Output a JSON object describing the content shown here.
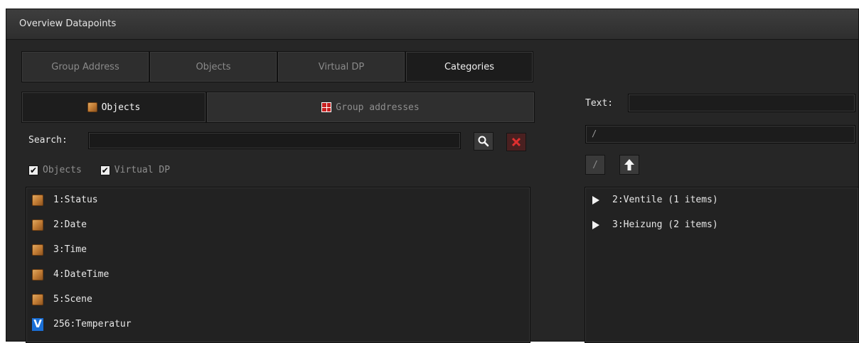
{
  "window": {
    "title": "Overview Datapoints"
  },
  "tabs": [
    {
      "label": "Group Address",
      "active": false
    },
    {
      "label": "Objects",
      "active": false
    },
    {
      "label": "Virtual DP",
      "active": false
    },
    {
      "label": "Categories",
      "active": true
    }
  ],
  "subtabs": {
    "objects": {
      "label": "Objects",
      "icon": "cube-icon"
    },
    "group_addresses": {
      "label": "Group addresses",
      "icon": "group-address-grid-icon"
    }
  },
  "search": {
    "label": "Search:",
    "value": ""
  },
  "filters": [
    {
      "label": "Objects",
      "checked": true
    },
    {
      "label": "Virtual DP",
      "checked": true
    }
  ],
  "objects_list": [
    {
      "label": "1:Status",
      "icon": "cube-icon"
    },
    {
      "label": "2:Date",
      "icon": "cube-icon"
    },
    {
      "label": "3:Time",
      "icon": "cube-icon"
    },
    {
      "label": "4:DateTime",
      "icon": "cube-icon"
    },
    {
      "label": "5:Scene",
      "icon": "cube-icon"
    },
    {
      "label": "256:Temperatur",
      "icon": "virtual-dp-icon"
    }
  ],
  "right_panel": {
    "text_label": "Text:",
    "text_value": "",
    "path_value": "/",
    "root_button": "/",
    "categories": [
      {
        "label": "2:Ventile (1 items)"
      },
      {
        "label": "3:Heizung (2 items)"
      }
    ]
  },
  "colors": {
    "background": "#262626",
    "vdp_icon": "#1a6fd6",
    "clear_icon": "#c62020"
  }
}
